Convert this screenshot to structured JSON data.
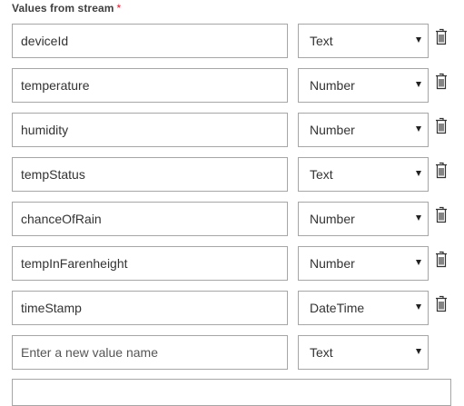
{
  "section": {
    "label": "Values from stream",
    "required_marker": "*"
  },
  "rows": [
    {
      "name": "deviceId",
      "type": "Text"
    },
    {
      "name": "temperature",
      "type": "Number"
    },
    {
      "name": "humidity",
      "type": "Number"
    },
    {
      "name": "tempStatus",
      "type": "Text"
    },
    {
      "name": "chanceOfRain",
      "type": "Number"
    },
    {
      "name": "tempInFarenheight",
      "type": "Number"
    },
    {
      "name": "timeStamp",
      "type": "DateTime"
    }
  ],
  "new_row": {
    "placeholder": "Enter a new value name",
    "type": "Text"
  },
  "icons": {
    "delete": "trash-icon",
    "dropdown": "chevron-down-icon"
  },
  "colors": {
    "border": "#a6a6a6",
    "required": "#e81123",
    "text": "#333333"
  }
}
